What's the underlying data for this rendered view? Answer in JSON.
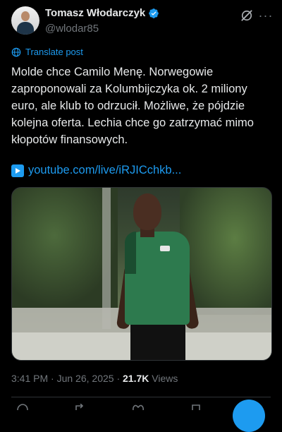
{
  "author": {
    "name": "Tomasz Włodarczyk",
    "handle": "@wlodar85"
  },
  "header_icons": {
    "grok": "grok-icon",
    "more": "more-icon"
  },
  "translate": {
    "label": "Translate post",
    "icon": "globe-icon"
  },
  "tweet": {
    "text": "Molde chce Camilo Menę. Norwegowie zaproponowali za Kolumbijczyka ok. 2 miliony euro, ale klub to odrzucił. Możliwe, że pójdzie kolejna oferta. Lechia chce go zatrzymać mimo kłopotów finansowych.",
    "link_icon": "play-button-icon",
    "link": "youtube.com/live/iRJICchkb..."
  },
  "meta": {
    "time": "3:41 PM",
    "separator": "·",
    "date": "Jun 26, 2025",
    "views_count": "21.7K",
    "views_label": "Views"
  },
  "colors": {
    "background": "#000000",
    "text": "#e7e9ea",
    "muted": "#71767b",
    "accent": "#1d9bf0",
    "border": "#2f3336"
  }
}
